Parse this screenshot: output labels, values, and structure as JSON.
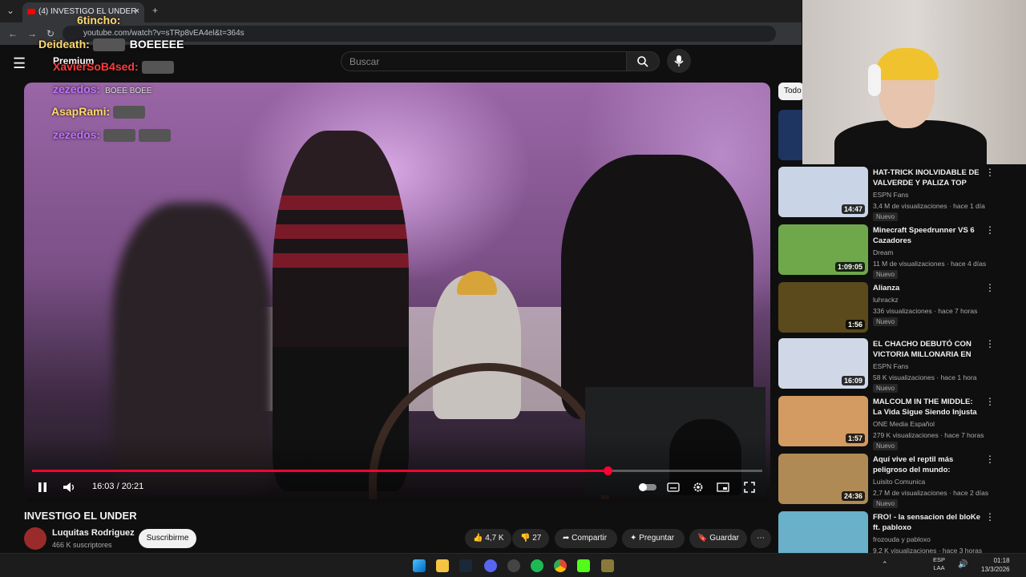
{
  "browser": {
    "tab_title": "(4) INVESTIGO EL UNDER",
    "tab_close": "×",
    "new_tab": "+",
    "url": "youtube.com/watch?v=sTRp8vEA4el&t=364s"
  },
  "yt": {
    "search_placeholder": "Buscar",
    "chip_all": "Todo"
  },
  "chat": [
    {
      "user": "6tincho:",
      "message": ""
    },
    {
      "user": "Deideath:",
      "message": "BOEEEEE"
    },
    {
      "user": "Premium",
      "message": ""
    },
    {
      "user": "XavierSoB4sed:",
      "message": ""
    },
    {
      "user": "zezedos:",
      "message": "BOEE BOEE"
    },
    {
      "user": "AsapRami:",
      "message": ""
    },
    {
      "user": "zezedos:",
      "message": ""
    }
  ],
  "player": {
    "current_time": "16:03",
    "separator": " / ",
    "duration": "20:21",
    "progress_fraction": 0.788
  },
  "video": {
    "title": "INVESTIGO EL UNDER",
    "channel": "Luquitas Rodriguez",
    "subscribers": "466 K suscriptores",
    "subscribe_label": "Suscribirme",
    "likes": "4,7 K",
    "dislikes": "27",
    "share_label": "Compartir",
    "ask_label": "Preguntar",
    "save_label": "Guardar",
    "more_label": "⋯"
  },
  "recommendations": [
    {
      "title": "HAT-TRICK INOLVIDABLE DE VALVERDE Y PALIZA TOP DEL ...",
      "channel": "ESPN Fans",
      "meta": "3,4 M de visualizaciones · hace 1 día",
      "badge": "Nuevo",
      "duration": "14:47",
      "thumb_color": "#c9d4e6"
    },
    {
      "title": "Minecraft Speedrunner VS 6 Cazadores",
      "channel": "Dream",
      "meta": "11 M de visualizaciones · hace 4 días",
      "badge": "Nuevo",
      "duration": "1:09:05",
      "thumb_color": "#6fa84a"
    },
    {
      "title": "Alianza",
      "channel": "luhrackz",
      "meta": "336 visualizaciones · hace 7 horas",
      "badge": "Nuevo",
      "duration": "1:56",
      "thumb_color": "#5a4a1c"
    },
    {
      "title": "EL CHACHO DEBUTÓ CON VICTORIA MILLONARIA EN UN...",
      "channel": "ESPN Fans",
      "meta": "58 K visualizaciones · hace 1 hora",
      "badge": "Nuevo",
      "duration": "16:09",
      "thumb_color": "#d0d8e8"
    },
    {
      "title": "MALCOLM IN THE MIDDLE: La Vida Sigue Siendo Injusta ...",
      "channel": "ONE Media Español",
      "meta": "279 K visualizaciones · hace 7 horas",
      "badge": "Nuevo",
      "duration": "1:57",
      "thumb_color": "#d39a62"
    },
    {
      "title": "Aquí vive el reptil más peligroso del mundo: DRAGÓN DE ...",
      "channel": "Luisito Comunica",
      "meta": "2,7 M de visualizaciones · hace 2 días",
      "badge": "Nuevo",
      "duration": "24:36",
      "thumb_color": "#b08a55"
    },
    {
      "title": "FRO! - la sensacion del bloKe ft. pabloxo",
      "channel": "frozouda y pabloxo",
      "meta": "9,2 K visualizaciones · hace 3 horas",
      "badge": "",
      "duration": "",
      "thumb_color": "#6ab0c8"
    }
  ],
  "taskbar": {
    "lang_line1": "ESP",
    "lang_line2": "LAA",
    "time": "01:18",
    "date": "13/3/2026"
  },
  "colors": {
    "accent_red": "#ff0033",
    "bg": "#0f0f0f",
    "surface": "#272727"
  }
}
